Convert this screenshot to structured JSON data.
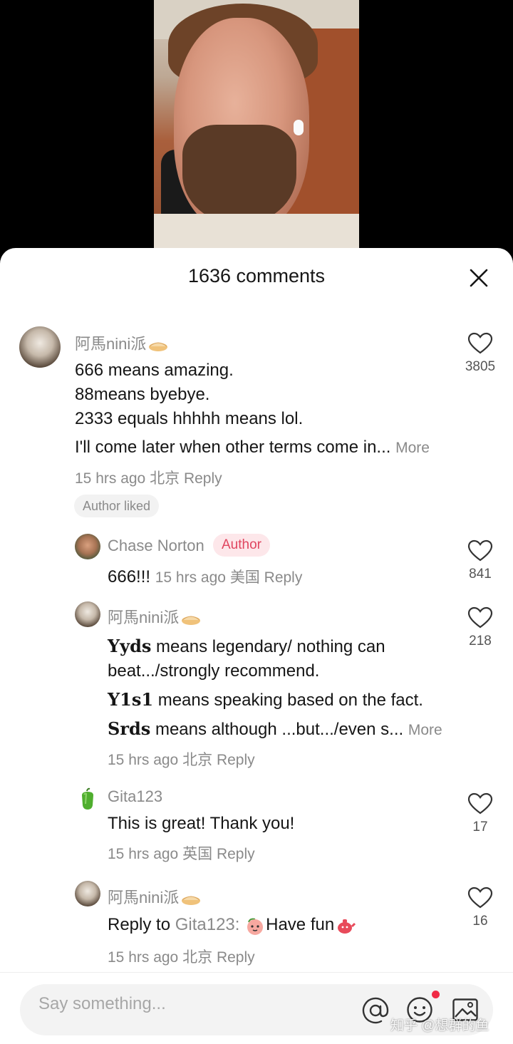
{
  "header": {
    "comments_count": "1636 comments"
  },
  "comments": [
    {
      "username": "阿馬nini派",
      "lines": [
        "666 means amazing.",
        "88means byebye.",
        "2333 equals hhhhh means lol.",
        "I'll come later when other terms come in..."
      ],
      "more": "More",
      "time": "15 hrs ago",
      "location": "北京",
      "reply": "Reply",
      "badge": "Author liked",
      "likes": "3805"
    },
    {
      "username": "Chase Norton",
      "author_badge": "Author",
      "text": "666!!!",
      "time": "15 hrs ago",
      "location": "美国",
      "reply": "Reply",
      "likes": "841"
    },
    {
      "username": "阿馬nini派",
      "line1_term": "Yyds",
      "line1_rest": " means legendary/ nothing can",
      "line2": "beat.../strongly recommend.",
      "line3_term": "Y1s1",
      "line3_rest": " means speaking based on the fact.",
      "line4_term": "Srds",
      "line4_rest": " means although ...but.../even s...",
      "more": "More",
      "time": "15 hrs ago",
      "location": "北京",
      "reply": "Reply",
      "likes": "218"
    },
    {
      "username": "Gita123",
      "text": "This is great! Thank you!",
      "time": "15 hrs ago",
      "location": "英国",
      "reply": "Reply",
      "likes": "17"
    },
    {
      "username": "阿馬nini派",
      "reply_prefix": "Reply to",
      "reply_to": "Gita123",
      "colon": ":",
      "text": "Have fun",
      "time": "15 hrs ago",
      "location": "北京",
      "reply": "Reply",
      "likes": "16"
    }
  ],
  "input": {
    "placeholder": "Say something..."
  },
  "watermark": "知乎 @想群的鱼",
  "colors": {
    "author_badge": "#e0455f",
    "notification_dot": "#f02a45",
    "muted_text": "#8a8a8a"
  },
  "icons": [
    "close-icon",
    "heart-icon",
    "pie-emoji-icon",
    "pepper-avatar-icon",
    "peach-emoji-icon",
    "teapot-emoji-icon",
    "at-icon",
    "smiley-icon",
    "image-icon"
  ]
}
